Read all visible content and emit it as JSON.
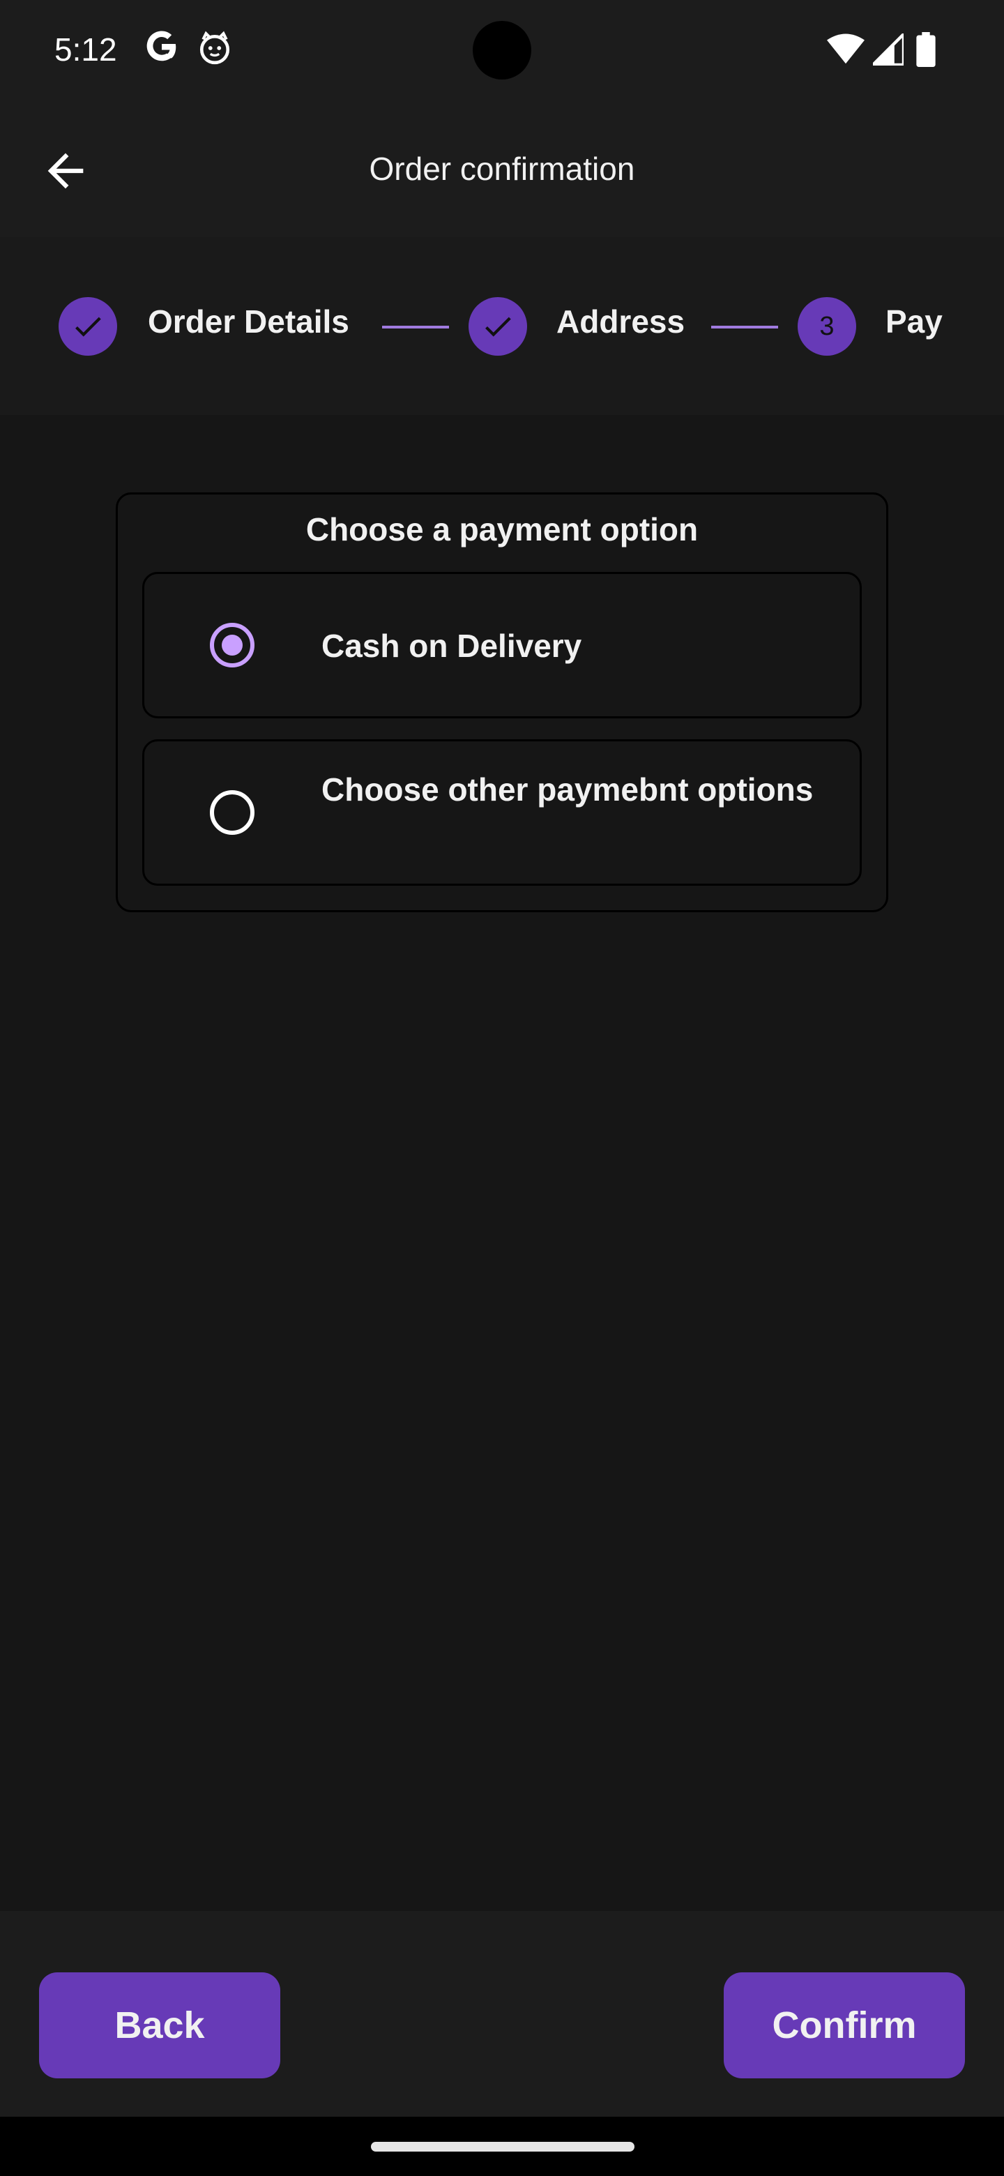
{
  "status_bar": {
    "time": "5:12",
    "icons": [
      "google-g-icon",
      "cat-face-icon",
      "wifi-icon",
      "cell-signal-icon",
      "battery-icon"
    ]
  },
  "app_bar": {
    "title": "Order confirmation",
    "back_icon": "arrow-back-icon"
  },
  "stepper": {
    "steps": [
      {
        "label": "Order Details",
        "state": "completed",
        "indicator": "check-icon"
      },
      {
        "label": "Address",
        "state": "completed",
        "indicator": "check-icon"
      },
      {
        "label": "Pay",
        "state": "active",
        "number": "3"
      }
    ]
  },
  "payment": {
    "title": "Choose a payment option",
    "options": [
      {
        "label": "Cash on Delivery",
        "selected": true
      },
      {
        "label": "Choose other paymebnt options",
        "selected": false
      }
    ]
  },
  "actions": {
    "back_label": "Back",
    "confirm_label": "Confirm"
  },
  "colors": {
    "accent": "#673ab7",
    "radio_selected": "#c9a0ff",
    "background": "#161616",
    "surface": "#1c1c1c"
  }
}
